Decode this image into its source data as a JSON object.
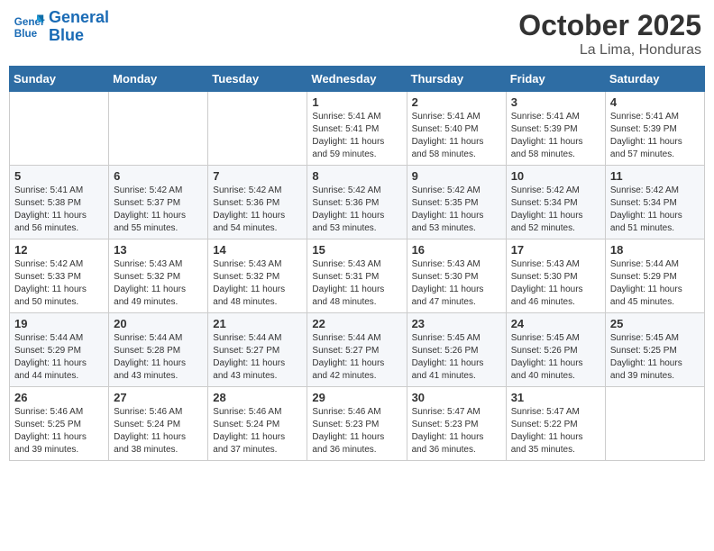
{
  "header": {
    "logo_line1": "General",
    "logo_line2": "Blue",
    "month_title": "October 2025",
    "location": "La Lima, Honduras"
  },
  "weekdays": [
    "Sunday",
    "Monday",
    "Tuesday",
    "Wednesday",
    "Thursday",
    "Friday",
    "Saturday"
  ],
  "weeks": [
    [
      {
        "day": "",
        "info": ""
      },
      {
        "day": "",
        "info": ""
      },
      {
        "day": "",
        "info": ""
      },
      {
        "day": "1",
        "info": "Sunrise: 5:41 AM\nSunset: 5:41 PM\nDaylight: 11 hours\nand 59 minutes."
      },
      {
        "day": "2",
        "info": "Sunrise: 5:41 AM\nSunset: 5:40 PM\nDaylight: 11 hours\nand 58 minutes."
      },
      {
        "day": "3",
        "info": "Sunrise: 5:41 AM\nSunset: 5:39 PM\nDaylight: 11 hours\nand 58 minutes."
      },
      {
        "day": "4",
        "info": "Sunrise: 5:41 AM\nSunset: 5:39 PM\nDaylight: 11 hours\nand 57 minutes."
      }
    ],
    [
      {
        "day": "5",
        "info": "Sunrise: 5:41 AM\nSunset: 5:38 PM\nDaylight: 11 hours\nand 56 minutes."
      },
      {
        "day": "6",
        "info": "Sunrise: 5:42 AM\nSunset: 5:37 PM\nDaylight: 11 hours\nand 55 minutes."
      },
      {
        "day": "7",
        "info": "Sunrise: 5:42 AM\nSunset: 5:36 PM\nDaylight: 11 hours\nand 54 minutes."
      },
      {
        "day": "8",
        "info": "Sunrise: 5:42 AM\nSunset: 5:36 PM\nDaylight: 11 hours\nand 53 minutes."
      },
      {
        "day": "9",
        "info": "Sunrise: 5:42 AM\nSunset: 5:35 PM\nDaylight: 11 hours\nand 53 minutes."
      },
      {
        "day": "10",
        "info": "Sunrise: 5:42 AM\nSunset: 5:34 PM\nDaylight: 11 hours\nand 52 minutes."
      },
      {
        "day": "11",
        "info": "Sunrise: 5:42 AM\nSunset: 5:34 PM\nDaylight: 11 hours\nand 51 minutes."
      }
    ],
    [
      {
        "day": "12",
        "info": "Sunrise: 5:42 AM\nSunset: 5:33 PM\nDaylight: 11 hours\nand 50 minutes."
      },
      {
        "day": "13",
        "info": "Sunrise: 5:43 AM\nSunset: 5:32 PM\nDaylight: 11 hours\nand 49 minutes."
      },
      {
        "day": "14",
        "info": "Sunrise: 5:43 AM\nSunset: 5:32 PM\nDaylight: 11 hours\nand 48 minutes."
      },
      {
        "day": "15",
        "info": "Sunrise: 5:43 AM\nSunset: 5:31 PM\nDaylight: 11 hours\nand 48 minutes."
      },
      {
        "day": "16",
        "info": "Sunrise: 5:43 AM\nSunset: 5:30 PM\nDaylight: 11 hours\nand 47 minutes."
      },
      {
        "day": "17",
        "info": "Sunrise: 5:43 AM\nSunset: 5:30 PM\nDaylight: 11 hours\nand 46 minutes."
      },
      {
        "day": "18",
        "info": "Sunrise: 5:44 AM\nSunset: 5:29 PM\nDaylight: 11 hours\nand 45 minutes."
      }
    ],
    [
      {
        "day": "19",
        "info": "Sunrise: 5:44 AM\nSunset: 5:29 PM\nDaylight: 11 hours\nand 44 minutes."
      },
      {
        "day": "20",
        "info": "Sunrise: 5:44 AM\nSunset: 5:28 PM\nDaylight: 11 hours\nand 43 minutes."
      },
      {
        "day": "21",
        "info": "Sunrise: 5:44 AM\nSunset: 5:27 PM\nDaylight: 11 hours\nand 43 minutes."
      },
      {
        "day": "22",
        "info": "Sunrise: 5:44 AM\nSunset: 5:27 PM\nDaylight: 11 hours\nand 42 minutes."
      },
      {
        "day": "23",
        "info": "Sunrise: 5:45 AM\nSunset: 5:26 PM\nDaylight: 11 hours\nand 41 minutes."
      },
      {
        "day": "24",
        "info": "Sunrise: 5:45 AM\nSunset: 5:26 PM\nDaylight: 11 hours\nand 40 minutes."
      },
      {
        "day": "25",
        "info": "Sunrise: 5:45 AM\nSunset: 5:25 PM\nDaylight: 11 hours\nand 39 minutes."
      }
    ],
    [
      {
        "day": "26",
        "info": "Sunrise: 5:46 AM\nSunset: 5:25 PM\nDaylight: 11 hours\nand 39 minutes."
      },
      {
        "day": "27",
        "info": "Sunrise: 5:46 AM\nSunset: 5:24 PM\nDaylight: 11 hours\nand 38 minutes."
      },
      {
        "day": "28",
        "info": "Sunrise: 5:46 AM\nSunset: 5:24 PM\nDaylight: 11 hours\nand 37 minutes."
      },
      {
        "day": "29",
        "info": "Sunrise: 5:46 AM\nSunset: 5:23 PM\nDaylight: 11 hours\nand 36 minutes."
      },
      {
        "day": "30",
        "info": "Sunrise: 5:47 AM\nSunset: 5:23 PM\nDaylight: 11 hours\nand 36 minutes."
      },
      {
        "day": "31",
        "info": "Sunrise: 5:47 AM\nSunset: 5:22 PM\nDaylight: 11 hours\nand 35 minutes."
      },
      {
        "day": "",
        "info": ""
      }
    ]
  ]
}
